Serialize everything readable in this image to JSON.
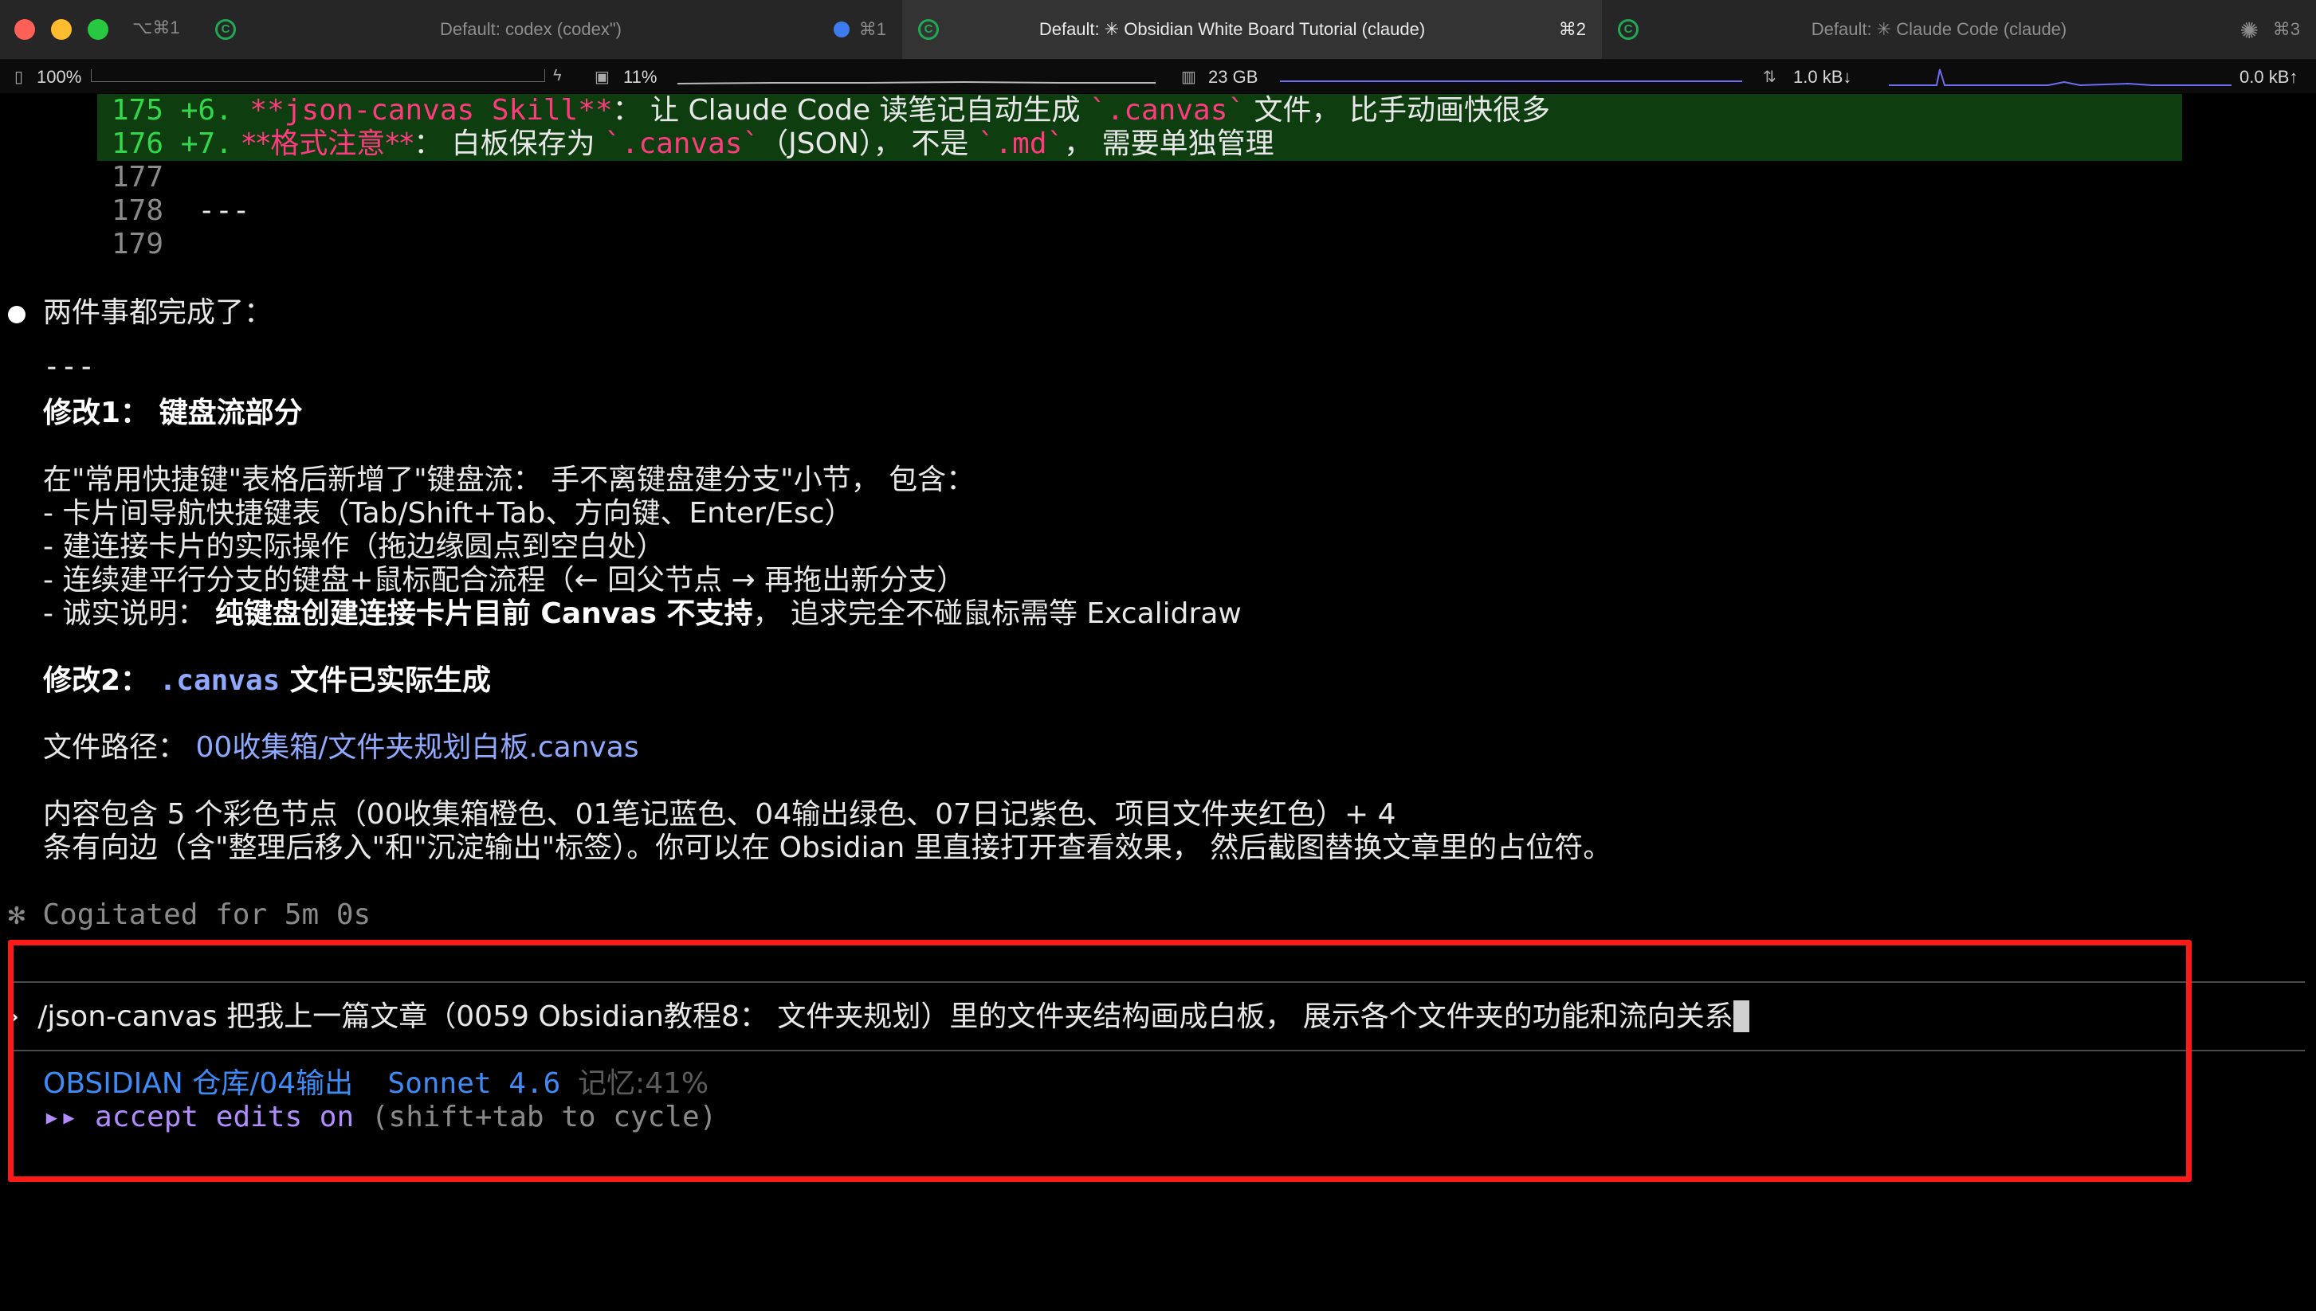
{
  "window": {
    "shortcut": "⌥⌘1"
  },
  "tabs": [
    {
      "title": "Default: codex (codex\")",
      "key": "⌘1",
      "active": false
    },
    {
      "title": "Default: ✳ Obsidian White Board Tutorial (claude)",
      "key": "⌘2",
      "active": true
    },
    {
      "title": "Default: ✳ Claude Code (claude)",
      "key": "⌘3",
      "active": false
    }
  ],
  "statusbar": {
    "battery": "100%",
    "battery_level": 1.0,
    "cpu": "11%",
    "memory": "23 GB",
    "network": "1.0 kB↓",
    "network_up": "0.0 kB↑"
  },
  "diff": {
    "lines": [
      {
        "num": "175",
        "prefix": "+6.",
        "rest_pink": " **json-canvas Skill**",
        "rest_white": "： 让 Claude Code 读笔记自动生成 ",
        "code": "`.canvas`",
        "tail": " 文件， 比手动画快很多"
      },
      {
        "num": "176",
        "prefix": "+7.",
        "rest_pink": " **格式注意**",
        "rest_white": "： 白板保存为 ",
        "code": "`.canvas`",
        "mid": "（JSON）， 不是 ",
        "code2": "`.md`",
        "tail": "， 需要单独管理"
      }
    ],
    "context": [
      {
        "num": "177",
        "text": ""
      },
      {
        "num": "178",
        "text": "---"
      },
      {
        "num": "179",
        "text": ""
      }
    ]
  },
  "response": {
    "intro": "两件事都完成了：",
    "rule": "---",
    "section1_title": "修改1： 键盘流部分",
    "section1_body": "在\"常用快捷键\"表格后新增了\"键盘流： 手不离键盘建分支\"小节， 包含：",
    "bullets": [
      "- 卡片间导航快捷键表（Tab/Shift+Tab、方向键、Enter/Esc）",
      "- 建连接卡片的实际操作（拖边缘圆点到空白处）",
      "- 连续建平行分支的键盘+鼠标配合流程（← 回父节点 → 再拖出新分支）"
    ],
    "honest_prefix": "- 诚实说明： ",
    "honest_bold": "纯键盘创建连接卡片目前 Canvas 不支持",
    "honest_suffix": "， 追求完全不碰鼠标需等 Excalidraw",
    "section2_prefix": "修改2： ",
    "section2_code": ".canvas",
    "section2_suffix": " 文件已实际生成",
    "path_label": "文件路径： ",
    "path_value": "00收集箱/文件夹规划白板.canvas",
    "content_line1": "内容包含 5 个彩色节点（00收集箱橙色、01笔记蓝色、04输出绿色、07日记紫色、项目文件夹红色）+ 4",
    "content_line2": "条有向边（含\"整理后移入\"和\"沉淀输出\"标签）。你可以在 Obsidian 里直接打开查看效果， 然后截图替换文章里的占位符。",
    "cogitated": "Cogitated for 5m 0s"
  },
  "input": {
    "caret": "›",
    "command": "/json-canvas",
    "text": " 把我上一篇文章（0059 Obsidian教程8： 文件夹规划）里的文件夹结构画成白板， 展示各个文件夹的功能和流向关系"
  },
  "footer": {
    "vault": "OBSIDIAN 仓库/04输出",
    "model": "Sonnet 4.6",
    "memory": "记忆:41%",
    "mode_arrows": "▸▸",
    "mode_text": "accept edits on",
    "mode_hint": "(shift+tab to cycle)"
  },
  "colors": {
    "highlight_box": "#ff1a1a",
    "diff_added_bg": "#0e3e10",
    "diff_markdown": "#ff3b7f",
    "link": "#8fa9ff",
    "vault": "#3e8bf5",
    "mode": "#b28cff"
  }
}
